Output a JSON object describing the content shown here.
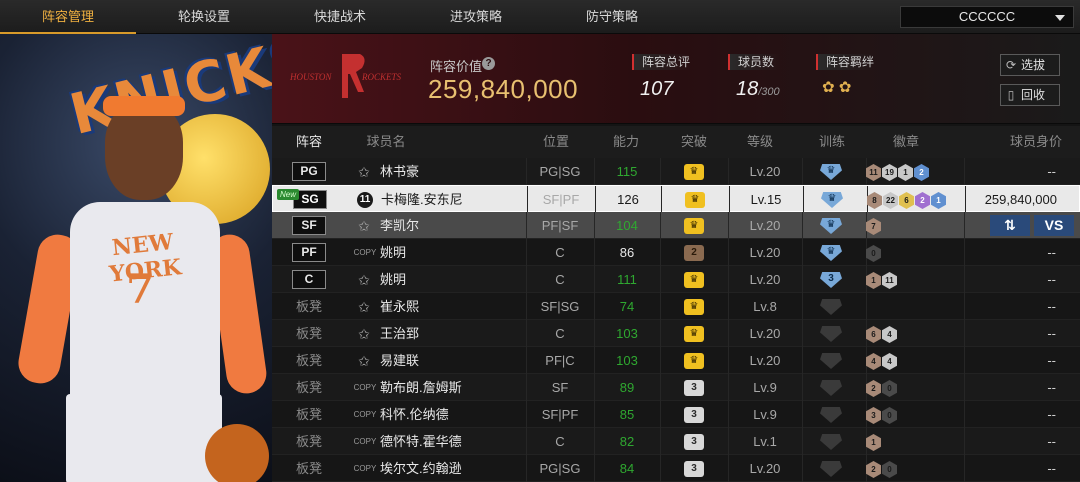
{
  "nav": {
    "tabs": [
      "阵容管理",
      "轮换设置",
      "快捷战术",
      "进攻策略",
      "防守策略"
    ],
    "active_tab": 0,
    "team_select": "CCCCCC"
  },
  "hero": {
    "logo_text": "KNICKS",
    "jersey_text": "NEW YORK",
    "jersey_number": "7"
  },
  "summary": {
    "team_logo_left": "HOUSTON",
    "team_logo_right": "ROCKETS",
    "value_label": "阵容价值",
    "value": "259,840,000",
    "rating_label": "阵容总评",
    "rating": "107",
    "players_label": "球员数",
    "players": "18",
    "players_max": "/300",
    "chem_label": "阵容羁绊",
    "chem_icons": "✿ ✿",
    "btn_select": "选拔",
    "btn_recycle": "回收"
  },
  "table": {
    "headers": [
      "阵容",
      "球员名",
      "位置",
      "能力",
      "突破",
      "等级",
      "训练",
      "徽章",
      "球员身价"
    ],
    "rows": [
      {
        "slot": "PG",
        "starter": true,
        "icon": "star",
        "name": "林书豪",
        "pos": "PG|SG",
        "ability": "115",
        "ability_green": true,
        "bt": "crown",
        "bt_text": "♛",
        "level": "Lv.20",
        "train": "blue",
        "train_text": "♛",
        "badges": [
          [
            "brown",
            "11"
          ],
          [
            "silver",
            "19"
          ],
          [
            "silver",
            "1"
          ],
          [
            "blue",
            "2"
          ]
        ],
        "price": "--"
      },
      {
        "slot": "SG",
        "starter": true,
        "new": "New",
        "icon": "num",
        "icon_text": "11",
        "name": "卡梅隆.安东尼",
        "pos": "SF|PF",
        "ability": "126",
        "ability_green": false,
        "bt": "crown",
        "bt_text": "♛",
        "level": "Lv.15",
        "train": "blue",
        "train_text": "♛",
        "badges": [
          [
            "brown",
            "8"
          ],
          [
            "silver",
            "22"
          ],
          [
            "gold",
            "6"
          ],
          [
            "purple",
            "2"
          ],
          [
            "blue",
            "1"
          ]
        ],
        "price": "259,840,000",
        "selected": true
      },
      {
        "slot": "SF",
        "starter": true,
        "icon": "star",
        "name": "李凯尔",
        "pos": "PF|SF",
        "ability": "104",
        "ability_green": true,
        "bt": "crown",
        "bt_text": "♛",
        "level": "Lv.20",
        "train": "blue",
        "train_text": "♛",
        "badges": [
          [
            "brown",
            "7"
          ]
        ],
        "price": "",
        "third": true,
        "actions": [
          "⇅",
          "VS"
        ]
      },
      {
        "slot": "PF",
        "starter": true,
        "icon": "copy",
        "icon_text": "COPY",
        "name": "姚明",
        "pos": "C",
        "ability": "86",
        "ability_green": false,
        "bt": "bronze",
        "bt_text": "2",
        "level": "Lv.20",
        "train": "blue",
        "train_text": "♛",
        "badges": [
          [
            "dark",
            "0"
          ]
        ],
        "price": "--"
      },
      {
        "slot": "C",
        "starter": true,
        "icon": "star",
        "name": "姚明",
        "pos": "C",
        "ability": "111",
        "ability_green": true,
        "bt": "crown",
        "bt_text": "♛",
        "level": "Lv.20",
        "train": "blue",
        "train_text": "3",
        "badges": [
          [
            "brown",
            "1"
          ],
          [
            "silver",
            "11"
          ]
        ],
        "price": "--"
      },
      {
        "slot": "板凳",
        "starter": false,
        "icon": "star",
        "name": "崔永熙",
        "pos": "SF|SG",
        "ability": "74",
        "ability_green": true,
        "bt": "crown",
        "bt_text": "♛",
        "level": "Lv.8",
        "train": "gray",
        "train_text": "",
        "badges": [],
        "price": "--"
      },
      {
        "slot": "板凳",
        "starter": false,
        "icon": "star",
        "name": "王治郅",
        "pos": "C",
        "ability": "103",
        "ability_green": true,
        "bt": "crown",
        "bt_text": "♛",
        "level": "Lv.20",
        "train": "gray",
        "train_text": "",
        "badges": [
          [
            "brown",
            "6"
          ],
          [
            "silver",
            "4"
          ]
        ],
        "price": "--"
      },
      {
        "slot": "板凳",
        "starter": false,
        "icon": "star",
        "name": "易建联",
        "pos": "PF|C",
        "ability": "103",
        "ability_green": true,
        "bt": "crown",
        "bt_text": "♛",
        "level": "Lv.20",
        "train": "gray",
        "train_text": "",
        "badges": [
          [
            "brown",
            "4"
          ],
          [
            "silver",
            "4"
          ]
        ],
        "price": "--"
      },
      {
        "slot": "板凳",
        "starter": false,
        "icon": "copy",
        "icon_text": "COPY",
        "name": "勒布朗.詹姆斯",
        "pos": "SF",
        "ability": "89",
        "ability_green": true,
        "bt": "num",
        "bt_text": "3",
        "level": "Lv.9",
        "train": "gray",
        "train_text": "",
        "badges": [
          [
            "brown",
            "2"
          ],
          [
            "dark",
            "0"
          ]
        ],
        "price": "--"
      },
      {
        "slot": "板凳",
        "starter": false,
        "icon": "copy",
        "icon_text": "COPY",
        "name": "科怀.伦纳德",
        "pos": "SF|PF",
        "ability": "85",
        "ability_green": true,
        "bt": "num",
        "bt_text": "3",
        "level": "Lv.9",
        "train": "gray",
        "train_text": "",
        "badges": [
          [
            "brown",
            "3"
          ],
          [
            "dark",
            "0"
          ]
        ],
        "price": "--"
      },
      {
        "slot": "板凳",
        "starter": false,
        "icon": "copy",
        "icon_text": "COPY",
        "name": "德怀特.霍华德",
        "pos": "C",
        "ability": "82",
        "ability_green": true,
        "bt": "num",
        "bt_text": "3",
        "level": "Lv.1",
        "train": "gray",
        "train_text": "",
        "badges": [
          [
            "brown",
            "1"
          ]
        ],
        "price": "--"
      },
      {
        "slot": "板凳",
        "starter": false,
        "icon": "copy",
        "icon_text": "COPY",
        "name": "埃尔文.约翰逊",
        "pos": "PG|SG",
        "ability": "84",
        "ability_green": true,
        "bt": "num",
        "bt_text": "3",
        "level": "Lv.20",
        "train": "gray",
        "train_text": "",
        "badges": [
          [
            "brown",
            "2"
          ],
          [
            "dark",
            "0"
          ]
        ],
        "price": "--"
      }
    ]
  }
}
